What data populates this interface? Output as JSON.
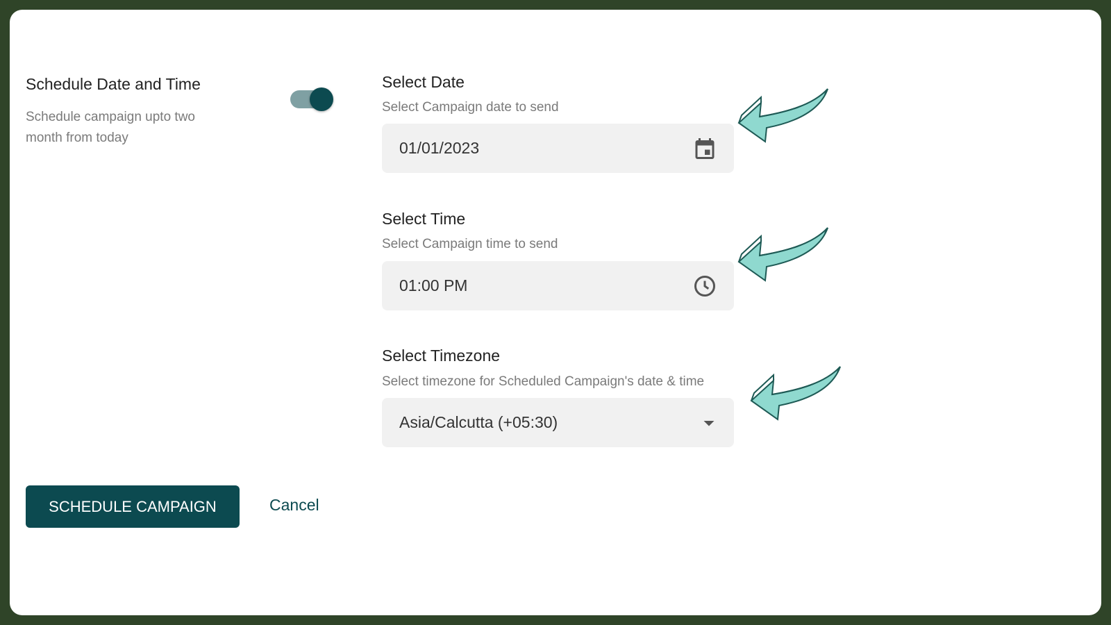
{
  "schedule": {
    "title": "Schedule Date and Time",
    "description": "Schedule campaign upto two month from today",
    "toggle_on": true
  },
  "date": {
    "label": "Select Date",
    "sublabel": "Select Campaign date to send",
    "value": "01/01/2023",
    "icon": "calendar-icon"
  },
  "time": {
    "label": "Select Time",
    "sublabel": "Select Campaign time to send",
    "value": "01:00 PM",
    "icon": "clock-icon"
  },
  "timezone": {
    "label": "Select Timezone",
    "sublabel": "Select timezone for Scheduled Campaign's date & time",
    "value": "Asia/Calcutta (+05:30)",
    "icon": "dropdown-arrow-icon"
  },
  "actions": {
    "schedule_label": "SCHEDULE CAMPAIGN",
    "cancel_label": "Cancel"
  },
  "colors": {
    "frame": "#2f4428",
    "primary": "#0c4a50",
    "arrow": "#8fd9cf"
  }
}
